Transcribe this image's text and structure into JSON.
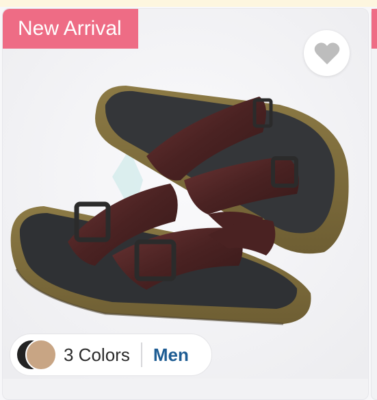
{
  "card": {
    "badge": "New Arrival",
    "wishlist_icon": "heart-icon",
    "colors_label": "3 Colors",
    "gender_label": "Men",
    "swatches": [
      "#222222",
      "#c8a584"
    ]
  },
  "colors": {
    "badge_bg": "#ee6c85",
    "gender_text": "#1d5c93",
    "heart": "#bdbdbd"
  }
}
